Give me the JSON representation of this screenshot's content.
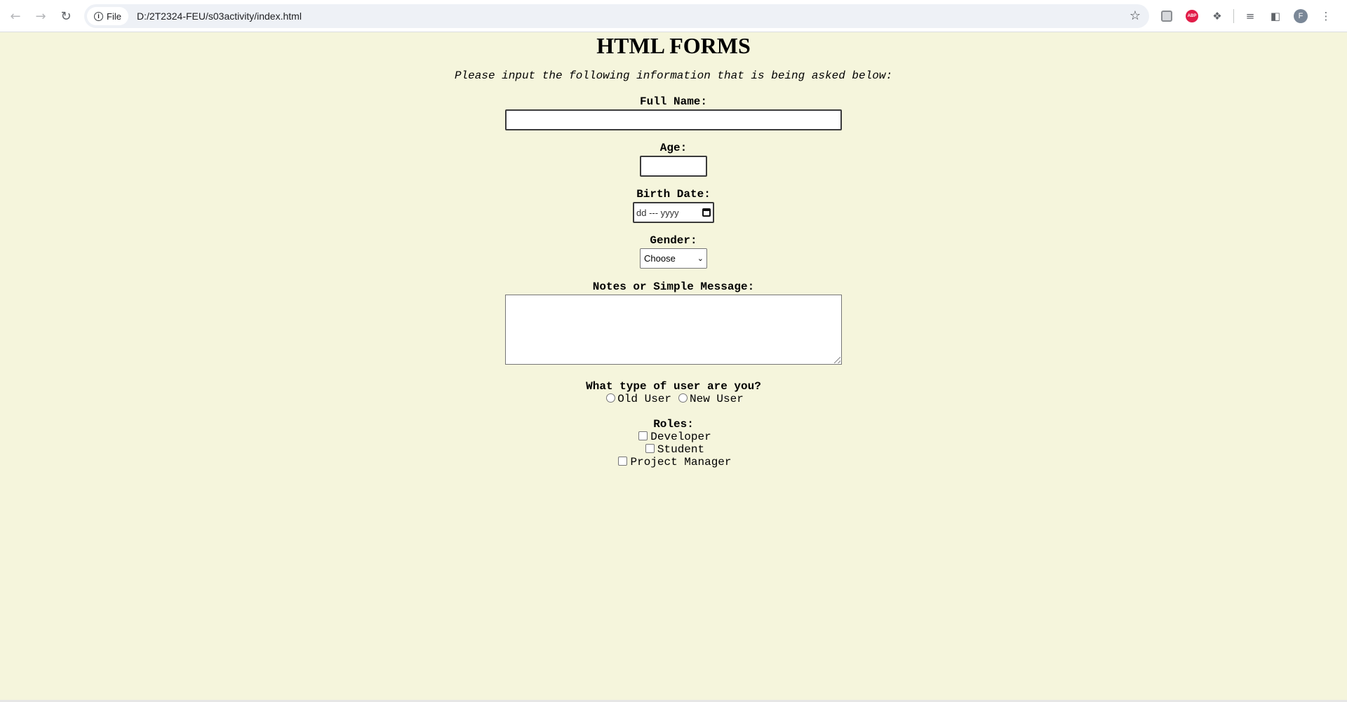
{
  "browser": {
    "url": "D:/2T2324-FEU/s03activity/index.html",
    "site_chip_label": "File",
    "abp_label": "ABP",
    "avatar_initial": "F"
  },
  "page": {
    "title": "HTML FORMS",
    "subtitle": "Please input the following information that is being asked below:"
  },
  "form": {
    "full_name_label": "Full Name:",
    "full_name_value": "",
    "age_label": "Age:",
    "age_value": "",
    "birth_date_label": "Birth Date:",
    "birth_date_placeholder": "dd --- yyyy",
    "gender_label": "Gender:",
    "gender_selected": "Choose",
    "notes_label": "Notes or Simple Message:",
    "notes_value": "",
    "user_type_label": "What type of user are you?",
    "user_types": [
      "Old User",
      "New User"
    ],
    "roles_label": "Roles:",
    "roles": [
      "Developer",
      "Student",
      "Project Manager"
    ]
  }
}
